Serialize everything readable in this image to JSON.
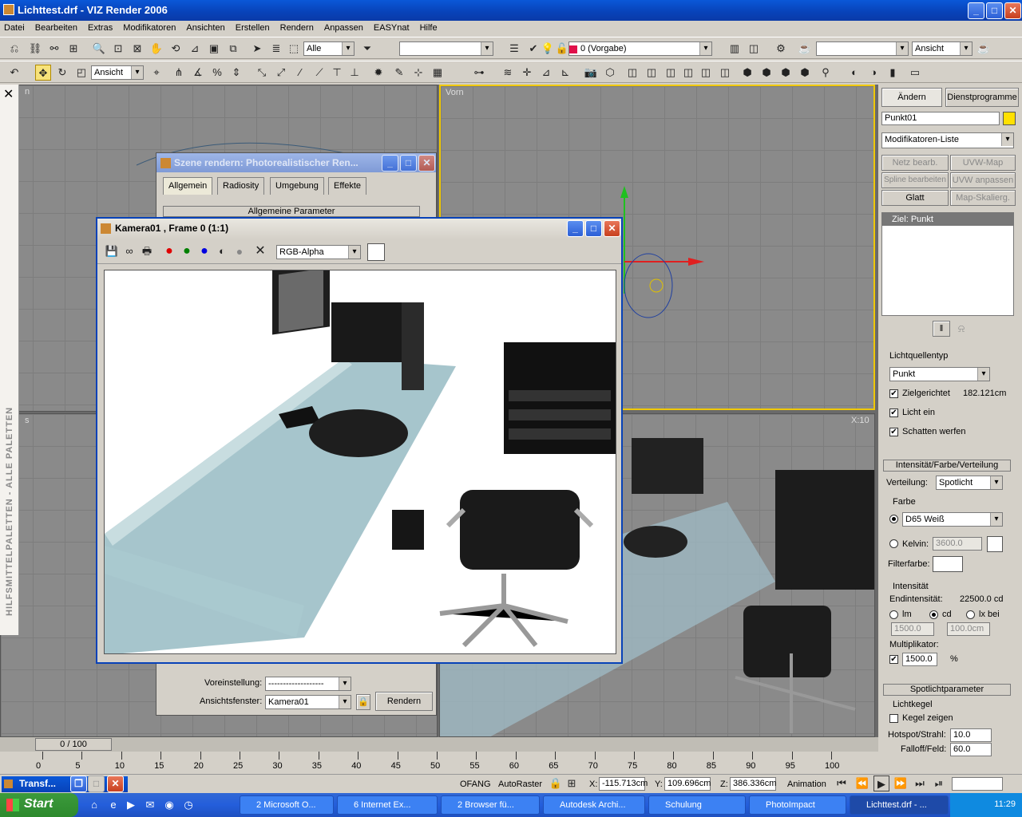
{
  "window": {
    "title": "Lichttest.drf - VIZ Render 2006"
  },
  "menu": [
    "Datei",
    "Bearbeiten",
    "Extras",
    "Modifikatoren",
    "Ansichten",
    "Erstellen",
    "Rendern",
    "Anpassen",
    "EASYnat",
    "Hilfe"
  ],
  "toolbar1": {
    "selection_filter": "Alle",
    "layer": "0 (Vorgabe)",
    "view": "Ansicht"
  },
  "toolbar2": {
    "coord_system": "Ansicht"
  },
  "viewports": {
    "top_left_label": "n",
    "top_right_label": "Vorn",
    "bottom_left_label": "s",
    "bottom_right_label": "X:10"
  },
  "side_palette": {
    "label": "HILFSMITTELPALETTEN - ALLE PALETTEN"
  },
  "render_dialog": {
    "title": "Szene rendern: Photorealistischer Ren...",
    "tabs": [
      "Allgemein",
      "Radiosity",
      "Umgebung",
      "Effekte"
    ],
    "section": "Allgemeine Parameter",
    "preset_label": "Voreinstellung:",
    "preset_value": "-------------------",
    "viewport_label": "Ansichtsfenster:",
    "viewport_value": "Kamera01",
    "render_button": "Rendern"
  },
  "frame_window": {
    "title": "Kamera01 , Frame 0 (1:1)",
    "channel": "RGB-Alpha"
  },
  "command_panel": {
    "tabs": [
      "Ändern",
      "Dienstprogramme"
    ],
    "object_name": "Punkt01",
    "object_color": "#ffe000",
    "modifier_list": "Modifikatoren-Liste",
    "buttons": [
      "Netz bearb.",
      "UVW-Map",
      "Spline bearbeiten",
      "UVW anpassen",
      "Glatt",
      "Map-Skalierg."
    ],
    "stack_item": "Ziel: Punkt",
    "light_type_label": "Lichtquellentyp",
    "light_type": "Punkt",
    "targeted_label": "Zielgerichtet",
    "targeted_value": "182.121cm",
    "light_on": "Licht ein",
    "cast_shadows": "Schatten werfen",
    "intensity_section": "Intensität/Farbe/Verteilung",
    "distribution_label": "Verteilung:",
    "distribution": "Spotlicht",
    "color_group": "Farbe",
    "color_preset": "D65 Weiß",
    "kelvin_label": "Kelvin:",
    "kelvin_value": "3600.0",
    "filter_label": "Filterfarbe:",
    "intensity_group": "Intensität",
    "end_intensity_label": "Endintensität:",
    "end_intensity_value": "22500.0 cd",
    "unit_lm": "lm",
    "unit_cd": "cd",
    "unit_lx": "lx bei",
    "lm_value": "1500.0",
    "dist_value": "100.0cm",
    "multiplier_label": "Multiplikator:",
    "multiplier_value": "1500.0",
    "percent": "%",
    "spot_section": "Spotlichtparameter",
    "cone_group": "Lichtkegel",
    "show_cone": "Kegel zeigen",
    "hotspot_label": "Hotspot/Strahl:",
    "hotspot_value": "10.0",
    "falloff_label": "Falloff/Feld:",
    "falloff_value": "60.0"
  },
  "timeline": {
    "frame": "0 / 100",
    "ticks": [
      "0",
      "5",
      "10",
      "15",
      "20",
      "25",
      "30",
      "35",
      "40",
      "45",
      "50",
      "55",
      "60",
      "65",
      "70",
      "75",
      "80",
      "85",
      "90",
      "95",
      "100"
    ]
  },
  "statusbar": {
    "snap": "OFANG",
    "autogrid": "AutoRaster",
    "x_label": "X:",
    "x": "-115.713cm",
    "y_label": "Y:",
    "y": "109.696cm",
    "z_label": "Z:",
    "z": "386.336cm",
    "animation": "Animation",
    "mini_title": "Transf..."
  },
  "taskbar": {
    "start": "Start",
    "tasks": [
      "2 Microsoft O...",
      "6 Internet Ex...",
      "2 Browser fü...",
      "Autodesk Archi...",
      "Schulung",
      "PhotoImpact",
      "Lichttest.drf - ..."
    ],
    "clock": "11:29"
  }
}
